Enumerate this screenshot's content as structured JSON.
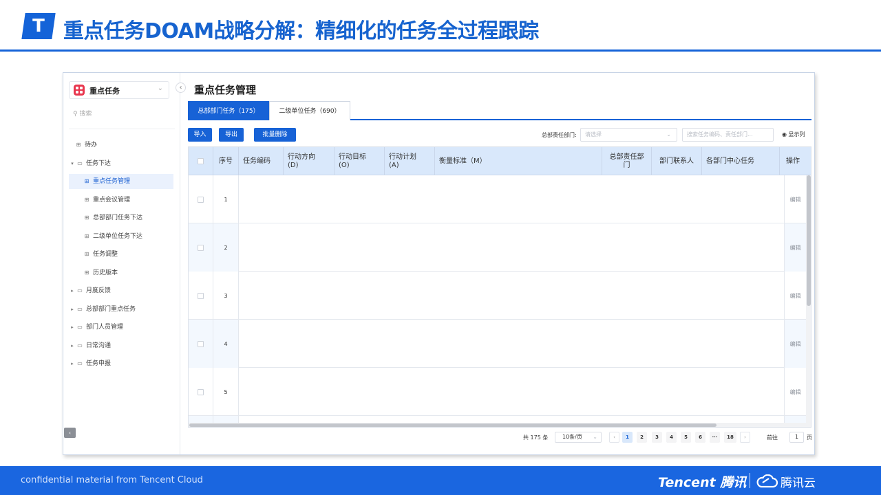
{
  "header": {
    "logo_glyph": "T",
    "title": "重点任务DOAM战略分解：精细化的任务全过程跟踪"
  },
  "footer": {
    "note": "confidential material from Tencent Cloud",
    "brand_en": "Tencent 腾讯",
    "brand_cloud": "腾讯云"
  },
  "sidebar": {
    "app_name": "重点任务",
    "search_placeholder": "搜索",
    "items": [
      {
        "label": "待办"
      },
      {
        "label": "任务下达"
      },
      {
        "label": "重点任务管理"
      },
      {
        "label": "重点会议管理"
      },
      {
        "label": "总部部门任务下达"
      },
      {
        "label": "二级单位任务下达"
      },
      {
        "label": "任务调整"
      },
      {
        "label": "历史版本"
      },
      {
        "label": "月度反馈"
      },
      {
        "label": "总部部门重点任务"
      },
      {
        "label": "部门人员管理"
      },
      {
        "label": "日常沟通"
      },
      {
        "label": "任务申报"
      }
    ]
  },
  "main": {
    "title": "重点任务管理",
    "tabs": [
      {
        "label": "总部部门任务（175）"
      },
      {
        "label": "二级单位任务（690）"
      }
    ],
    "toolbar": {
      "import_label": "导入",
      "export_label": "导出",
      "batch_delete_label": "批量删除",
      "filter_label": "总部责任部门:",
      "filter_placeholder": "请选择",
      "search_placeholder": "搜索任务编码、责任部门...",
      "columns_label": "显示列"
    },
    "table": {
      "headers": [
        "序号",
        "任务编码",
        "行动方向\n(D)",
        "行动目标\n(O)",
        "行动计划\n(A)",
        "衡量标准（M）",
        "总部责任部\n门",
        "部门联系人",
        "各部门中心任务",
        "操作"
      ],
      "rows": [
        {
          "no": "1",
          "action": "编辑"
        },
        {
          "no": "2",
          "action": "编辑"
        },
        {
          "no": "3",
          "action": "编辑"
        },
        {
          "no": "4",
          "action": "编辑"
        },
        {
          "no": "5",
          "action": "编辑"
        }
      ]
    },
    "pagination": {
      "total": "共 175 条",
      "page_size": "10条/页",
      "pages": [
        "1",
        "2",
        "3",
        "4",
        "5",
        "6",
        "···",
        "18"
      ],
      "goto_label": "前往",
      "goto_value": "1",
      "page_unit": "页"
    }
  },
  "colors": {
    "brand_blue": "#1762d6",
    "header_blue": "#1663cf",
    "footer_blue": "#1a66e0",
    "table_header_bg": "#d9e8fb",
    "app_icon_red": "#e8374e"
  }
}
